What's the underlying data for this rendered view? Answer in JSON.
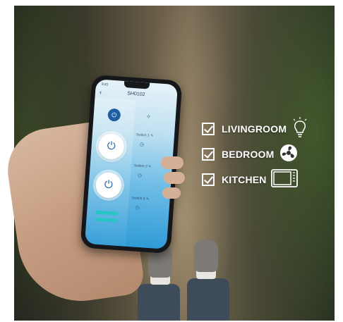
{
  "phone_app": {
    "status_time": "9:41",
    "device_title": "SH0102",
    "back_glyph": "‹",
    "rows": [
      {
        "label": "",
        "icon": "sparkle-icon"
      },
      {
        "label": "Switch 1",
        "icon": "timer-icon"
      },
      {
        "label": "Switch 2",
        "icon": "timer-icon"
      },
      {
        "label": "Switch 3",
        "icon": "timer-icon"
      }
    ],
    "accent": "#1e5fa3"
  },
  "features": [
    {
      "label": "LIVINGROOM",
      "icon": "lightbulb-icon"
    },
    {
      "label": "BEDROOM",
      "icon": "fan-icon"
    },
    {
      "label": "KITCHEN",
      "icon": "microwave-icon"
    }
  ]
}
